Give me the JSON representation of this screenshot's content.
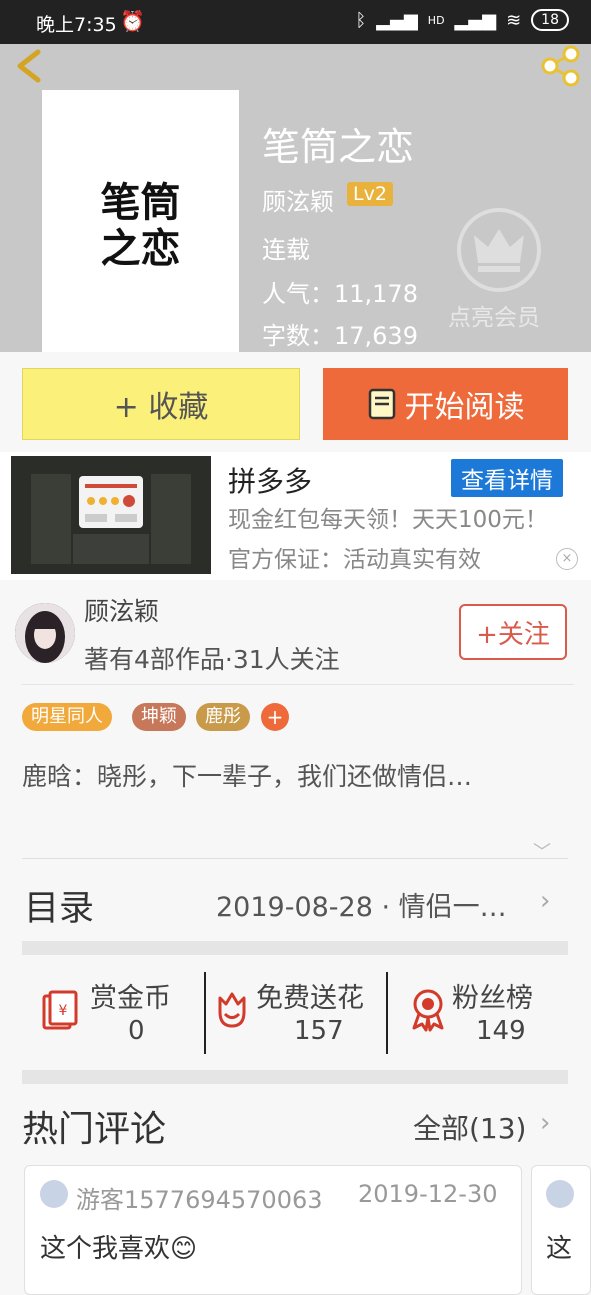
{
  "status_bar": {
    "time": "晚上7:35",
    "network": "HD",
    "battery": "18"
  },
  "book": {
    "cover_text_line1": "笔筒",
    "cover_text_line2": "之恋",
    "title": "笔筒之恋",
    "author": "顾泫颖",
    "level": "Lv2",
    "status": "连载",
    "popularity": "人气：11,178",
    "word_count": "字数：17,639",
    "member_label": "点亮会员"
  },
  "actions": {
    "collect": "+ 收藏",
    "read": "开始阅读"
  },
  "ad": {
    "title": "拼多多",
    "button": "查看详情",
    "description": "现金红包每天领！天天100元！官方保证：活动真实有效",
    "close": "×"
  },
  "author_card": {
    "name": "顾泫颖",
    "info": "著有4部作品·31人关注",
    "follow": "+关注"
  },
  "tags": [
    {
      "label": "明星同人",
      "color": "#f0a93a"
    },
    {
      "label": "坤颖",
      "color": "#c8785a"
    },
    {
      "label": "鹿彤",
      "color": "#c89a4a"
    }
  ],
  "tag_add": "+",
  "intro": "鹿晗：晓彤，下一辈子，我们还做情侣…",
  "toc": {
    "title": "目录",
    "latest": "2019-08-28 · 情侣一…"
  },
  "stats": [
    {
      "label": "赏金币",
      "value": "0",
      "icon": "red-envelope-icon"
    },
    {
      "label": "免费送花",
      "value": "157",
      "icon": "flower-icon"
    },
    {
      "label": "粉丝榜",
      "value": "149",
      "icon": "medal-icon"
    }
  ],
  "comments_section": {
    "title": "热门评论",
    "all": "全部(13)"
  },
  "comments": [
    {
      "user": "游客1577694570063",
      "date": "2019-12-30",
      "text": "这个我喜欢😊"
    },
    {
      "text": "这"
    }
  ],
  "colors": {
    "accent_orange": "#ef6a3a",
    "collect_yellow": "#fbf07a",
    "ad_blue": "#1c79d8",
    "level_gold": "#e9b23c"
  }
}
